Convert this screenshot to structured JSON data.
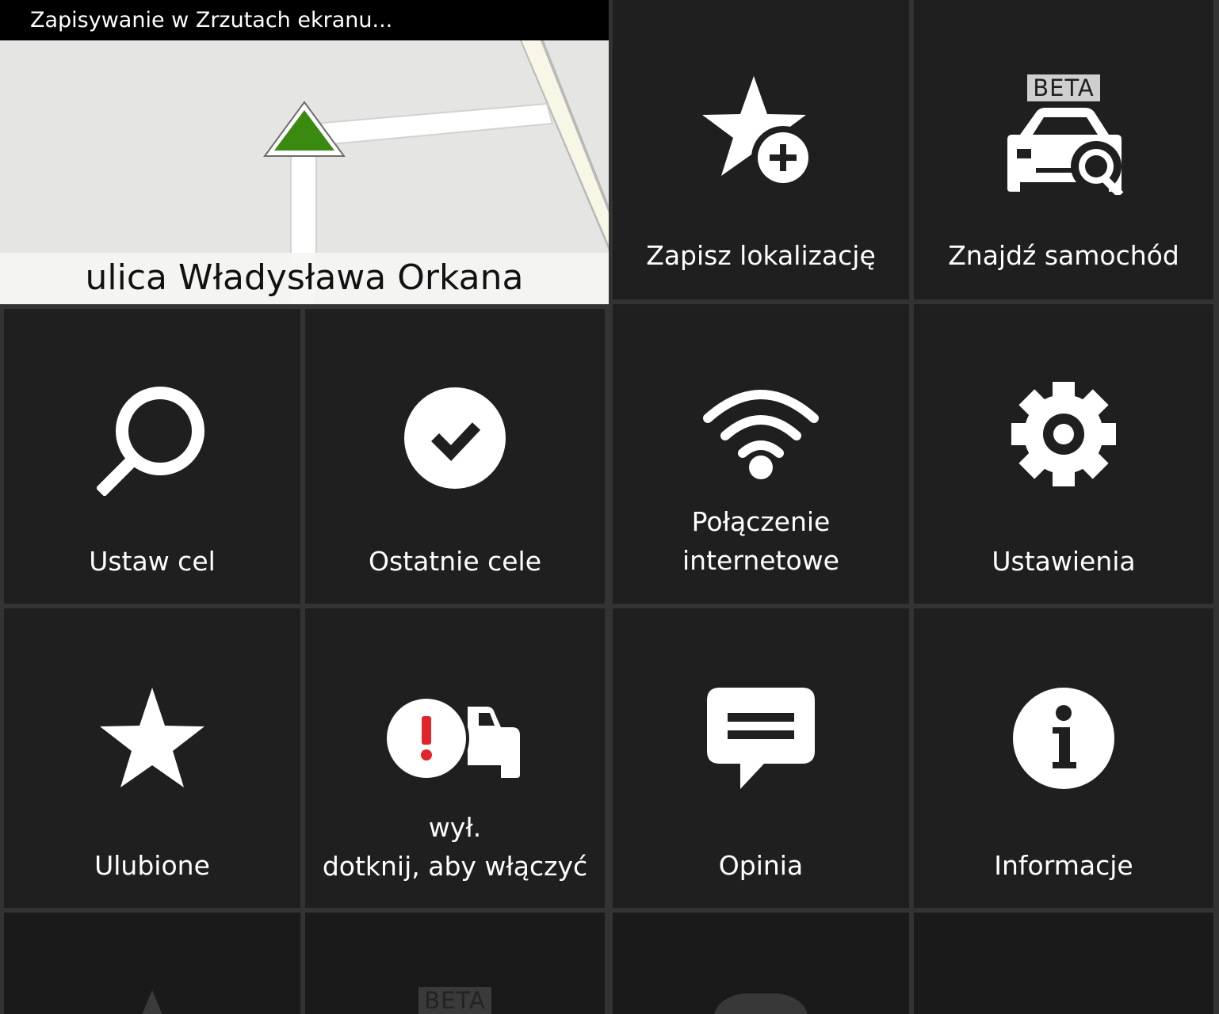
{
  "toast": {
    "text": "Zapisywanie w Zrzutach ekranu..."
  },
  "map": {
    "street_name": "ulica Władysława Orkana"
  },
  "tiles": {
    "save_location": {
      "label": "Zapisz lokalizację",
      "icon": "star-plus-icon"
    },
    "find_car": {
      "label": "Znajdź samochód",
      "badge": "BETA",
      "icon": "car-search-icon"
    },
    "set_destination": {
      "label": "Ustaw cel",
      "icon": "search-icon"
    },
    "recent_destinations": {
      "label": "Ostatnie cele",
      "icon": "check-circle-icon"
    },
    "internet_connection": {
      "line1": "Połączenie",
      "line2": "internetowe",
      "icon": "wifi-icon"
    },
    "settings": {
      "label": "Ustawienia",
      "icon": "gear-icon"
    },
    "favorites": {
      "label": "Ulubione",
      "icon": "star-icon"
    },
    "traffic_alerts": {
      "line1": "wył.",
      "line2": "dotknij, aby włączyć",
      "icon": "traffic-alert-icon"
    },
    "feedback": {
      "label": "Opinia",
      "icon": "chat-bubble-icon"
    },
    "info": {
      "label": "Informacje",
      "icon": "info-icon"
    },
    "partial_beta": {
      "badge": "BETA"
    }
  },
  "colors": {
    "tile_bg": "#1f1f1f",
    "grid_gap": "#333333",
    "position_arrow": "#3a8a12",
    "alert_red": "#e0262b"
  }
}
